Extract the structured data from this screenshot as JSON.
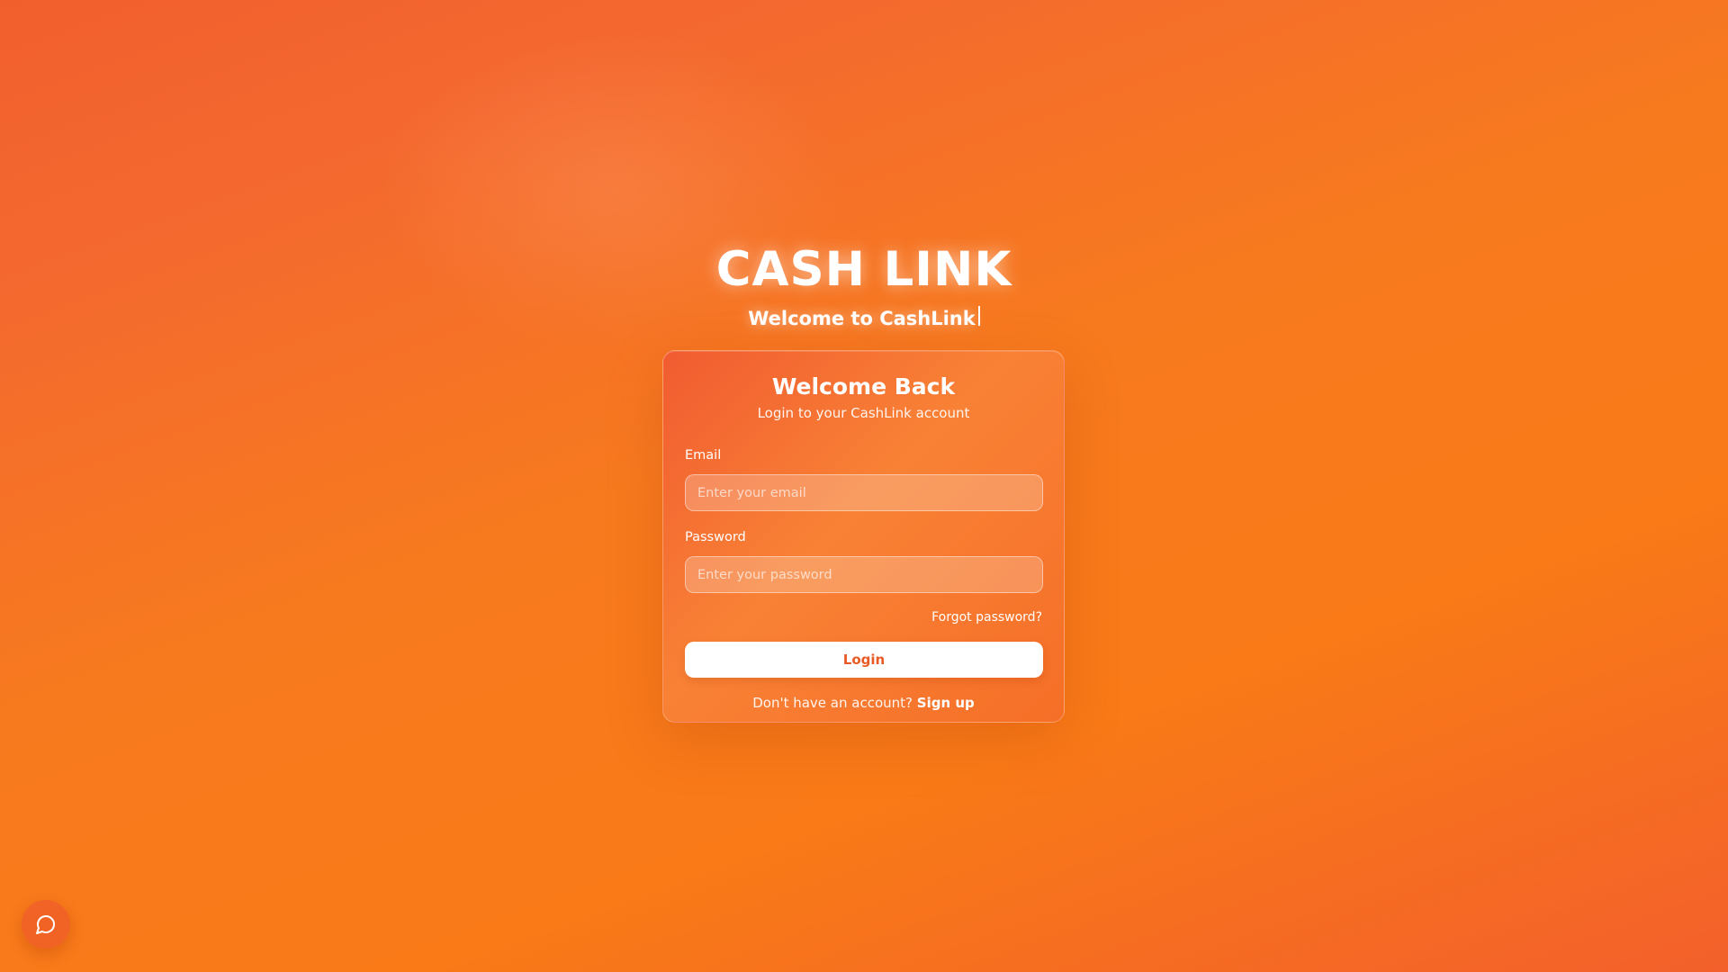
{
  "brand": {
    "title": "CASH LINK",
    "subtitle": "Welcome to CashLink"
  },
  "login_card": {
    "title": "Welcome Back",
    "subtitle": "Login to your CashLink account",
    "email": {
      "label": "Email",
      "value": "",
      "placeholder": "Enter your email"
    },
    "password": {
      "label": "Password",
      "value": "",
      "placeholder": "Enter your password"
    },
    "forgot_password_link": "Forgot password?",
    "login_button": "Login",
    "signup_prompt": "Don't have an account?",
    "signup_link": "Sign up"
  },
  "chat_widget": {
    "icon": "chat-bubble-icon"
  },
  "colors": {
    "background_primary": "#f97a17",
    "background_secondary": "#f15f2d",
    "accent_text": "#ea5a24",
    "text_primary": "#ffffff"
  }
}
